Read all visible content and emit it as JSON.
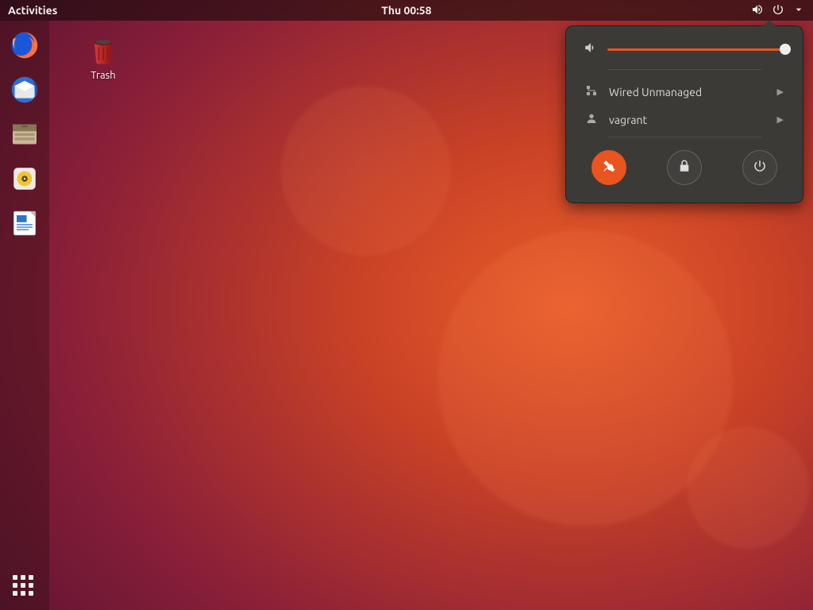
{
  "topbar": {
    "activities": "Activities",
    "datetime": "Thu 00:58"
  },
  "desktop": {
    "trash_label": "Trash"
  },
  "system_menu": {
    "network_label": "Wired Unmanaged",
    "user_label": "vagrant"
  },
  "colors": {
    "accent": "#e95420",
    "panel": "#3b3a36"
  }
}
